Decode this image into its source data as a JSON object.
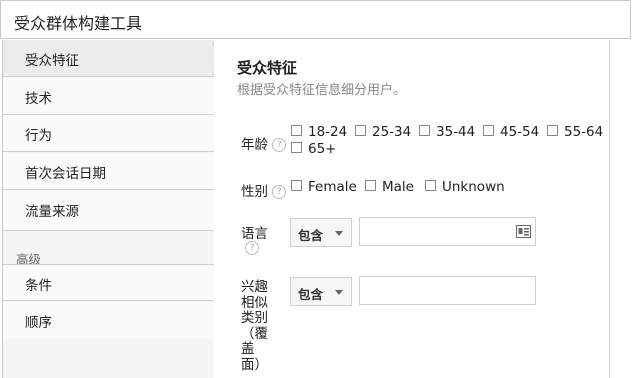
{
  "app": {
    "title": "受众群体构建工具"
  },
  "sidebar": {
    "items": [
      {
        "label": "受众特征"
      },
      {
        "label": "技术"
      },
      {
        "label": "行为"
      },
      {
        "label": "首次会话日期"
      },
      {
        "label": "流量来源"
      }
    ],
    "advanced_section": "高级",
    "advanced_items": [
      {
        "label": "条件"
      },
      {
        "label": "顺序"
      }
    ]
  },
  "main": {
    "title": "受众特征",
    "subtitle": "根据受众特征信息细分用户。",
    "help_glyph": "?",
    "age": {
      "label": "年龄",
      "options": [
        "18-24",
        "25-34",
        "35-44",
        "45-54",
        "55-64",
        "65+"
      ]
    },
    "gender": {
      "label": "性别",
      "options": [
        "Female",
        "Male",
        "Unknown"
      ]
    },
    "language": {
      "label": "语言",
      "operator": "包含",
      "value": ""
    },
    "affinity": {
      "label_lines": [
        "兴趣",
        "相似",
        "类别",
        "（覆",
        "盖",
        "面）"
      ],
      "operator": "包含",
      "value": ""
    }
  }
}
